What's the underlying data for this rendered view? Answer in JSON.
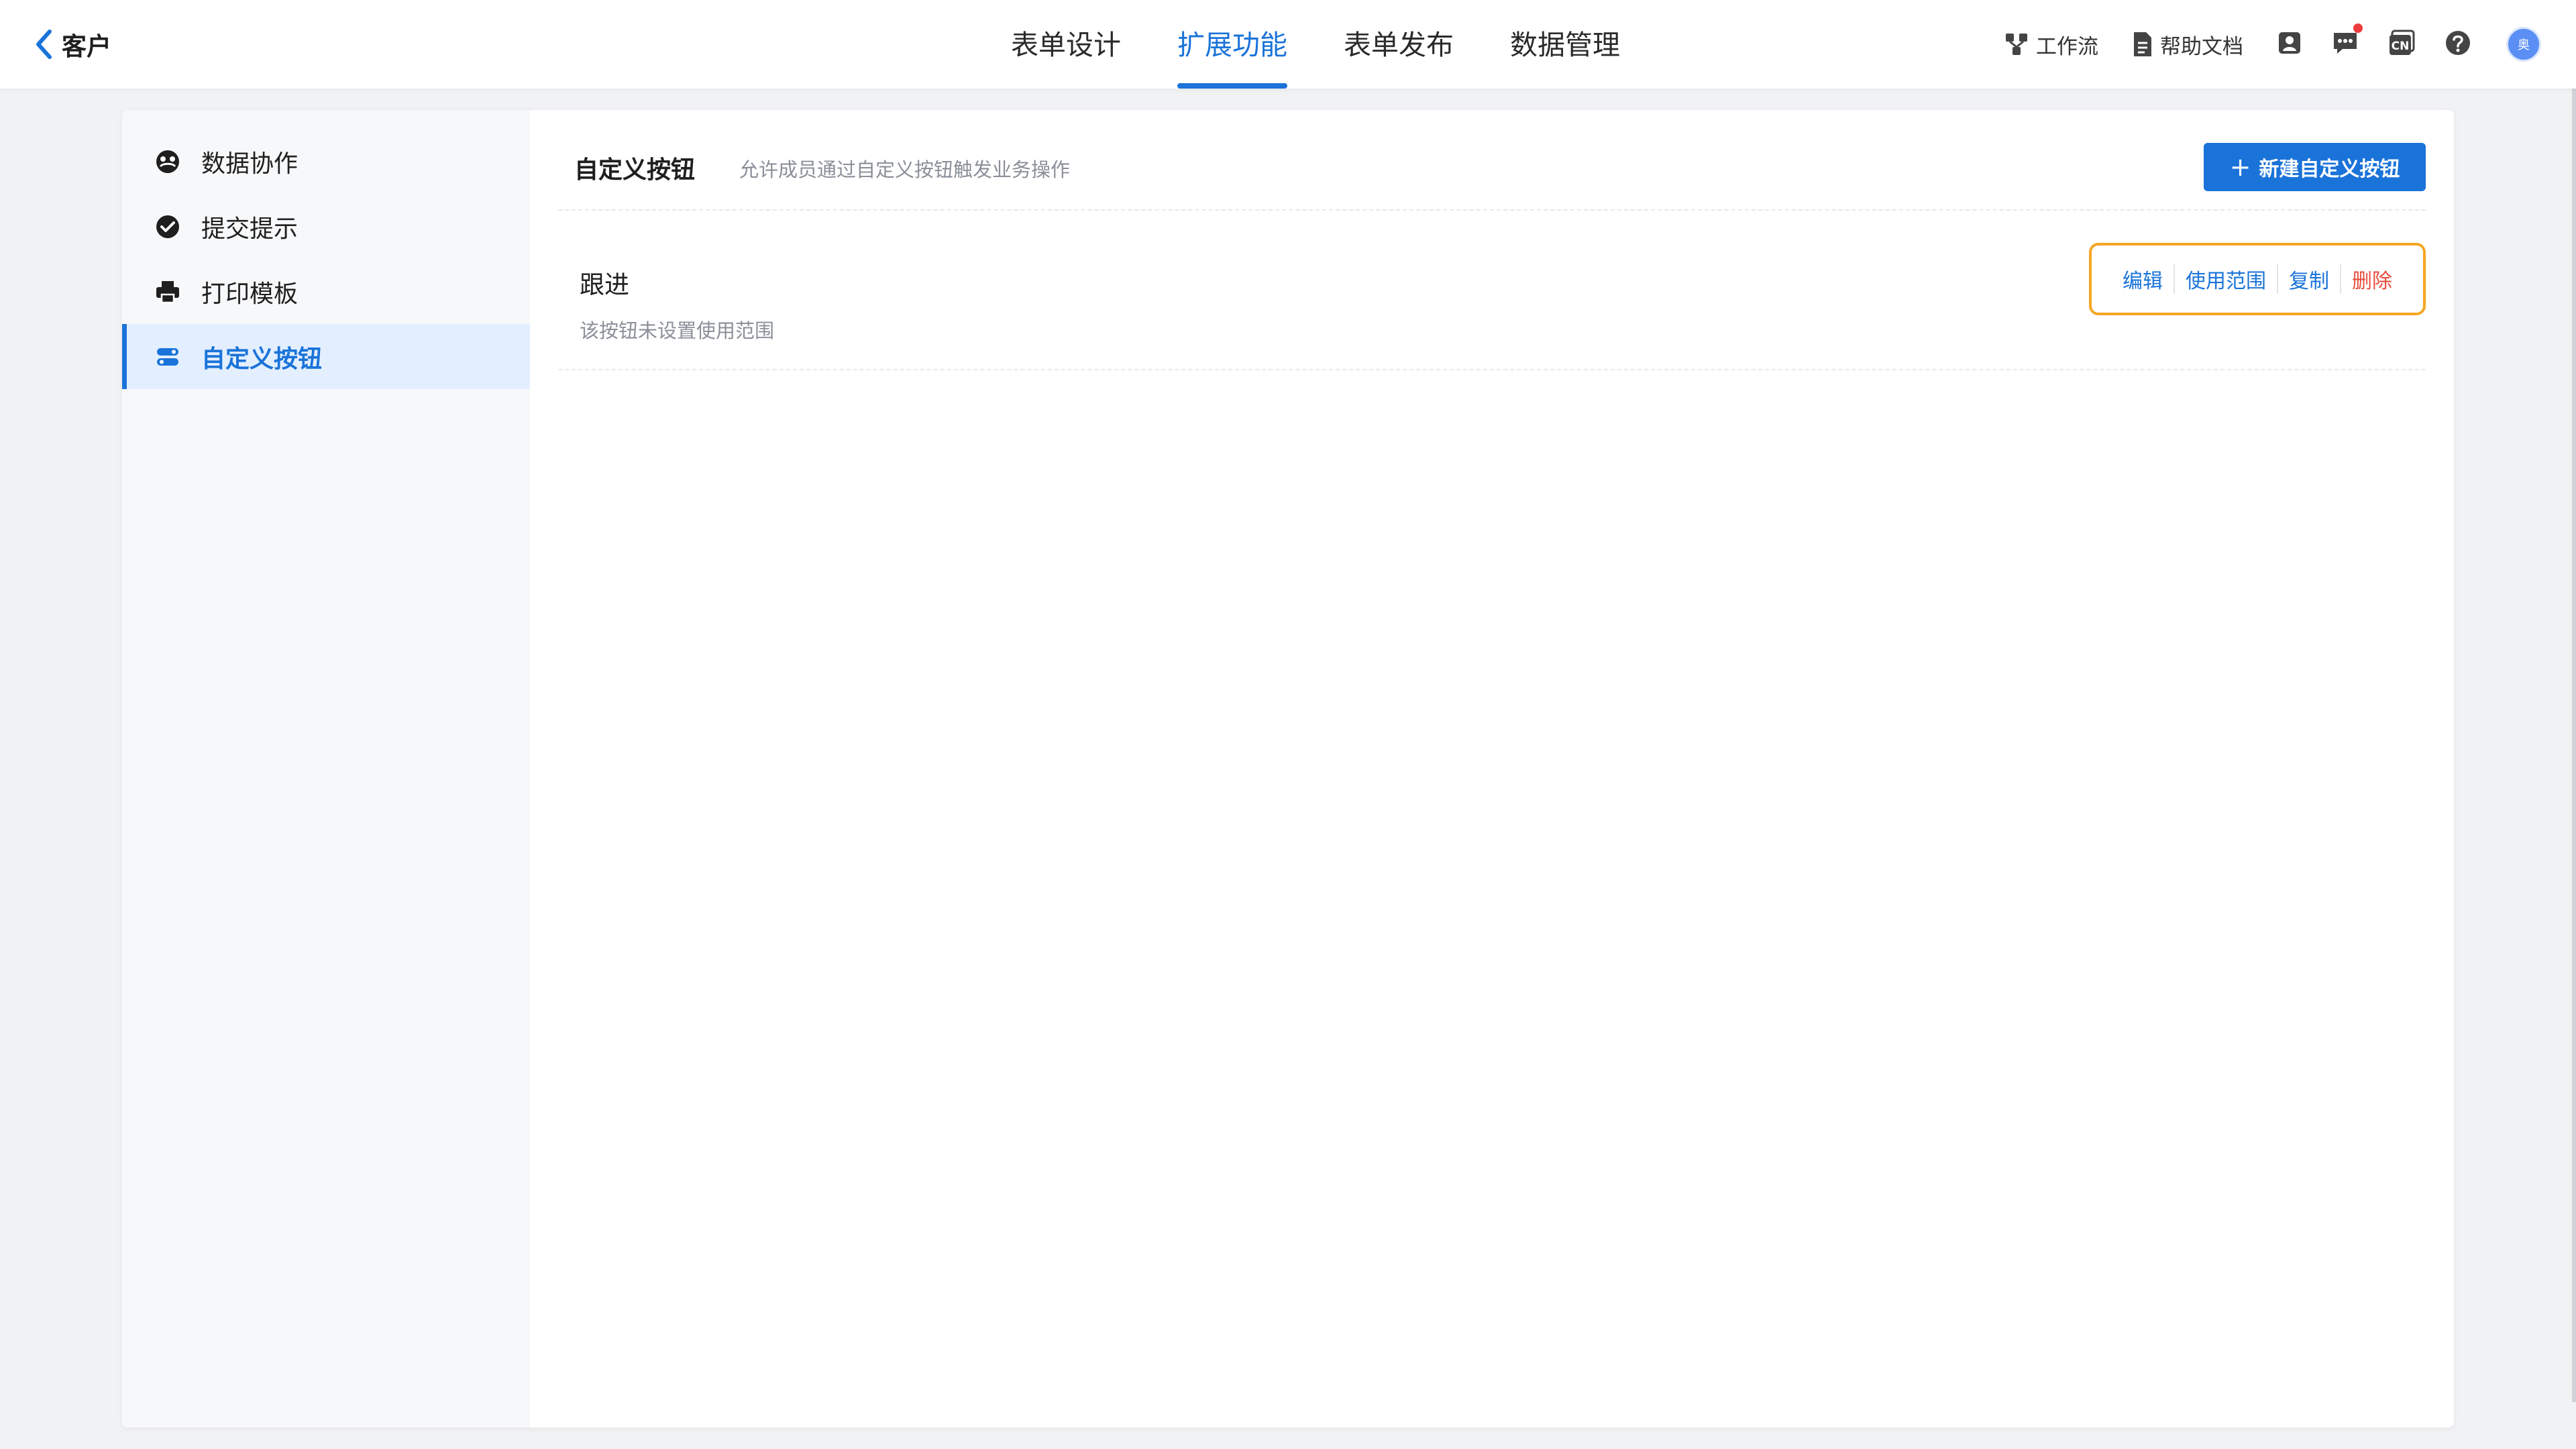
{
  "header": {
    "app_title": "客户",
    "tabs": [
      {
        "label": "表单设计",
        "active": false
      },
      {
        "label": "扩展功能",
        "active": true
      },
      {
        "label": "表单发布",
        "active": false
      },
      {
        "label": "数据管理",
        "active": false
      }
    ],
    "tools": {
      "workflow_label": "工作流",
      "help_label": "帮助文档",
      "lang_badge": "CN",
      "help_icon": "question-circle-icon",
      "avatar_text": "奥"
    }
  },
  "sidebar": {
    "items": [
      {
        "label": "数据协作",
        "icon": "data-collab-icon",
        "active": false
      },
      {
        "label": "提交提示",
        "icon": "check-circle-icon",
        "active": false
      },
      {
        "label": "打印模板",
        "icon": "printer-icon",
        "active": false
      },
      {
        "label": "自定义按钮",
        "icon": "toggle-buttons-icon",
        "active": true
      }
    ]
  },
  "content": {
    "title": "自定义按钮",
    "description": "允许成员通过自定义按钮触发业务操作",
    "new_button_label": "新建自定义按钮",
    "buttons": [
      {
        "name": "跟进",
        "scope_hint": "该按钮未设置使用范围",
        "actions": {
          "edit": "编辑",
          "scope": "使用范围",
          "copy": "复制",
          "delete": "删除"
        }
      }
    ]
  },
  "colors": {
    "accent": "#1a73d9",
    "danger": "#e74c3c",
    "highlight": "#f5a623"
  }
}
